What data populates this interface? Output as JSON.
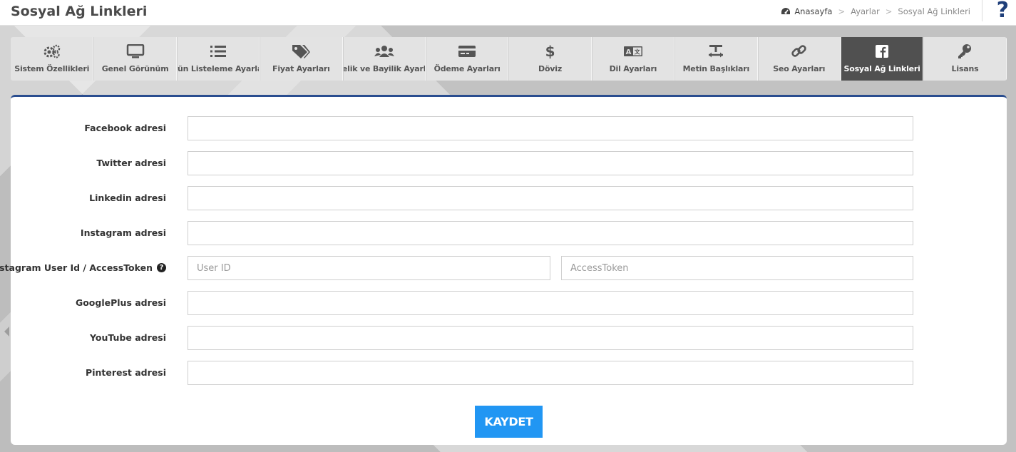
{
  "header": {
    "title": "Sosyal Ağ Linkleri",
    "breadcrumb": [
      "Anasayfa",
      "Ayarlar",
      "Sosyal Ağ Linkleri"
    ],
    "breadcrumb_separator": ">",
    "help_label": "?"
  },
  "tabs": [
    {
      "label": "Sistem Özellikleri",
      "icon": "gears-icon"
    },
    {
      "label": "Genel Görünüm",
      "icon": "monitor-icon"
    },
    {
      "label": "Ürün Listeleme Ayarları",
      "icon": "list-icon"
    },
    {
      "label": "Fiyat Ayarları",
      "icon": "tags-icon"
    },
    {
      "label": "Üyelik ve Bayilik Ayarları",
      "icon": "users-icon"
    },
    {
      "label": "Ödeme Ayarları",
      "icon": "credit-card-icon"
    },
    {
      "label": "Döviz",
      "icon": "dollar-icon"
    },
    {
      "label": "Dil Ayarları",
      "icon": "language-icon"
    },
    {
      "label": "Metin Başlıkları",
      "icon": "text-height-icon"
    },
    {
      "label": "Seo Ayarları",
      "icon": "link-icon"
    },
    {
      "label": "Sosyal Ağ Linkleri",
      "icon": "facebook-icon",
      "active": true
    },
    {
      "label": "Lisans",
      "icon": "key-icon"
    }
  ],
  "form": {
    "fields": [
      {
        "label": "Facebook adresi",
        "value": ""
      },
      {
        "label": "Twitter adresi",
        "value": ""
      },
      {
        "label": "Linkedin adresi",
        "value": ""
      },
      {
        "label": "Instagram adresi",
        "value": ""
      },
      {
        "label": "Instagram User Id / AccessToken",
        "placeholder1": "User ID",
        "placeholder2": "AccessToken"
      },
      {
        "label": "GooglePlus adresi",
        "value": ""
      },
      {
        "label": "YouTube adresi",
        "value": ""
      },
      {
        "label": "Pinterest adresi",
        "value": ""
      }
    ],
    "save_label": "KAYDET"
  },
  "colors": {
    "accent": "#2196f3",
    "panel_border": "#2a4d8f",
    "active_tab": "#505050",
    "help": "#1f3f7a"
  }
}
